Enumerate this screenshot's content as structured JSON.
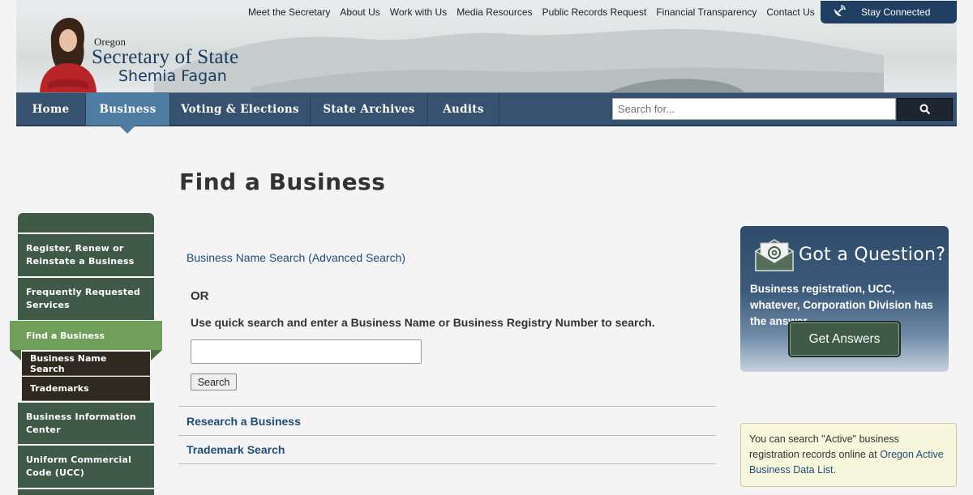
{
  "header": {
    "logo_small": "Oregon",
    "logo_big": "Secretary of State",
    "logo_name": "Shemia Fagan",
    "top_links": [
      "Meet the Secretary",
      "About Us",
      "Work with Us",
      "Media Resources",
      "Public Records Request",
      "Financial Transparency",
      "Contact Us"
    ],
    "stay_connected": "Stay Connected"
  },
  "nav": {
    "items": [
      {
        "label": "Home",
        "active": false
      },
      {
        "label": "Business",
        "active": true
      },
      {
        "label": "Voting & Elections",
        "active": false
      },
      {
        "label": "State Archives",
        "active": false
      },
      {
        "label": "Audits",
        "active": false
      }
    ],
    "search_placeholder": "Search for...",
    "search_icon": "search-icon"
  },
  "page": {
    "title": "Find a Business"
  },
  "sidebar": {
    "items": [
      {
        "label": "Register, Renew or Reinstate a Business"
      },
      {
        "label": "Frequently Requested Services"
      },
      {
        "label": "Find a Business",
        "active": true
      },
      {
        "label": "Business Information Center"
      },
      {
        "label": "Uniform Commercial Code (UCC)"
      }
    ],
    "sub_items": [
      {
        "label": "Business Name Search"
      },
      {
        "label": "Trademarks"
      }
    ]
  },
  "main": {
    "business_name_search": "Business Name Search (Advanced Search)",
    "or": "OR",
    "instructions": "Use quick search and enter a Business Name or Business Registry Number to search.",
    "search_value": "",
    "search_button": "Search",
    "research_link": "Research a Business",
    "trademark_link": "Trademark Search"
  },
  "question_box": {
    "title": "Got a Question?",
    "text": "Business registration, UCC, whatever, Corporation Division has the answer.",
    "button": "Get Answers"
  },
  "note": {
    "text": "You can search \"Active\" business registration records online at ",
    "link": "Oregon Active Business Data List",
    "suffix": "."
  },
  "colors": {
    "nav_bg": "#36526e",
    "nav_active": "#4f7ca3",
    "sidebar_bg": "#3f5a47",
    "sidebar_active": "#6f9f5a",
    "link": "#1f4e79"
  }
}
